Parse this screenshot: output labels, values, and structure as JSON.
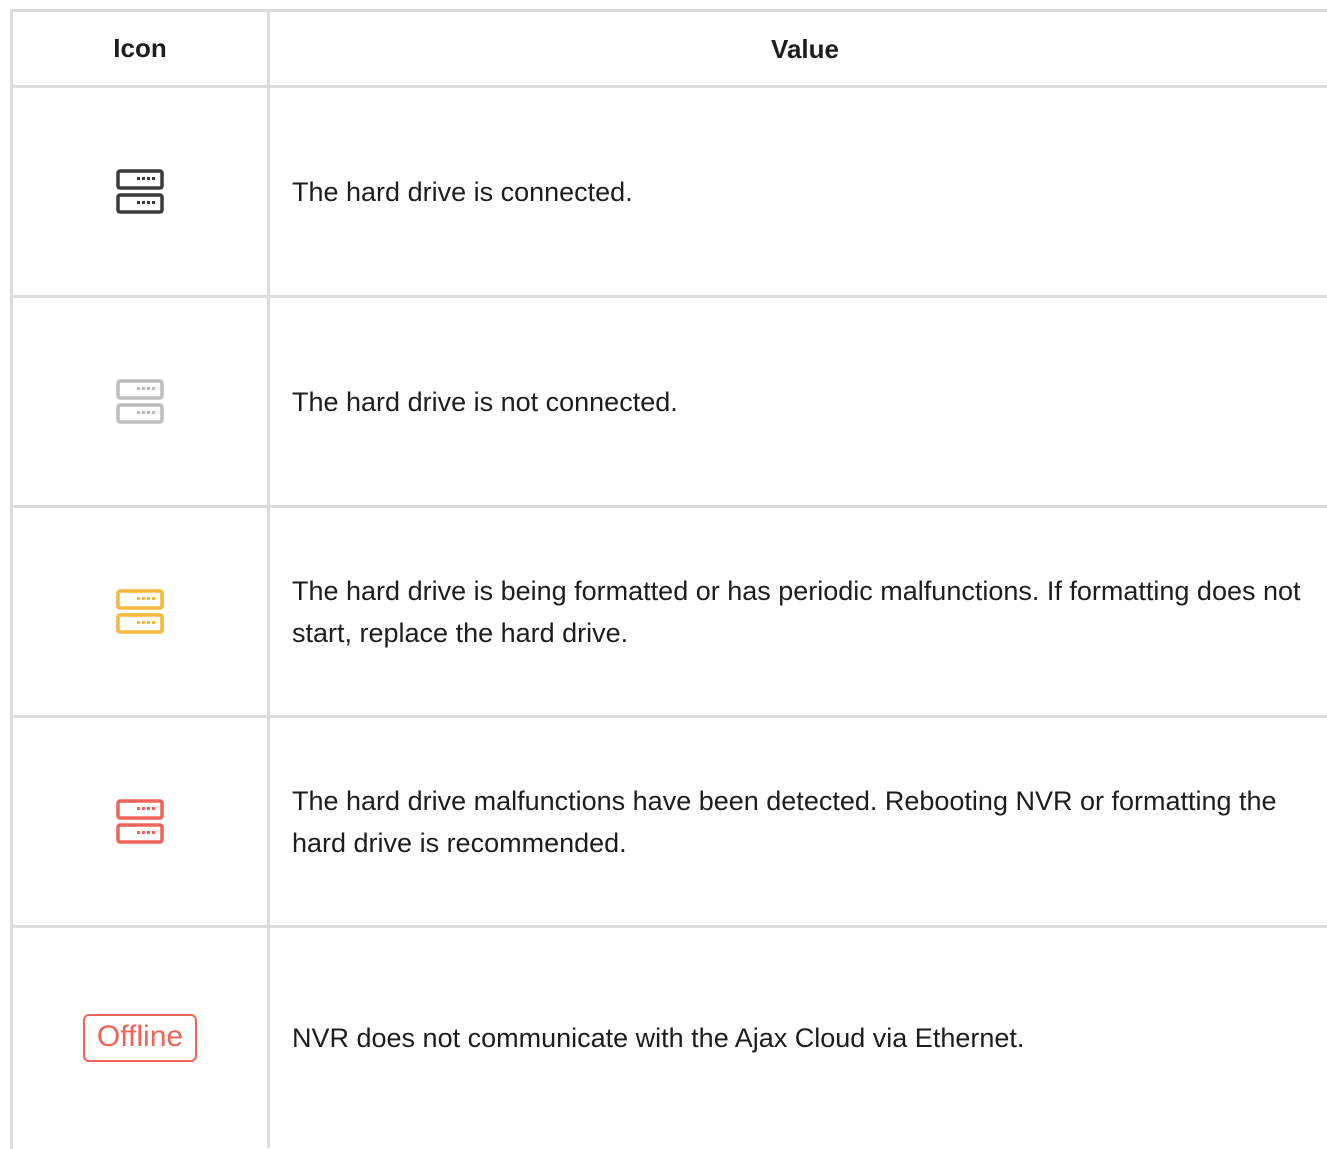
{
  "table": {
    "headers": {
      "icon": "Icon",
      "value": "Value"
    },
    "rows": [
      {
        "icon": "hard-drive-connected-icon",
        "icon_color": "#3a3a3a",
        "value": "The hard drive is connected."
      },
      {
        "icon": "hard-drive-not-connected-icon",
        "icon_color": "#bdbdbd",
        "value": "The hard drive is not connected."
      },
      {
        "icon": "hard-drive-formatting-icon",
        "icon_color": "#f5b73b",
        "value": "The hard drive is being formatted or has periodic malfunctions. If formatting does not start, replace the hard drive."
      },
      {
        "icon": "hard-drive-malfunction-icon",
        "icon_color": "#f0645a",
        "value": "The hard drive malfunctions have been detected. Rebooting NVR or formatting the hard drive is recommended."
      },
      {
        "icon": "offline-badge",
        "icon_color": "#f0645a",
        "badge_text": "Offline",
        "value": "NVR does not communicate with the Ajax Cloud via Ethernet."
      }
    ]
  }
}
